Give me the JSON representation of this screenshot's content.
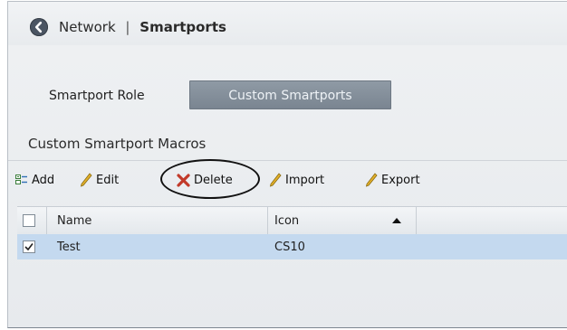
{
  "header": {
    "breadcrumb_parent": "Network",
    "breadcrumb_separator": "|",
    "breadcrumb_current": "Smartports"
  },
  "tabs": [
    {
      "label": "Smartport Role",
      "active": false
    },
    {
      "label": "Custom Smartports",
      "active": true
    }
  ],
  "section": {
    "title": "Custom Smartport Macros"
  },
  "toolbar": {
    "add": "Add",
    "edit": "Edit",
    "delete": "Delete",
    "import": "Import",
    "export": "Export"
  },
  "table": {
    "columns": [
      "Name",
      "Icon"
    ],
    "sort_column": "Icon",
    "rows": [
      {
        "checked": true,
        "name": "Test",
        "icon": "CS10"
      }
    ]
  },
  "colors": {
    "accent_tab": "#7f8a95",
    "selected_row": "#c4d9ef",
    "delete_icon": "#c0392b",
    "pencil_icon": "#d4a017"
  }
}
